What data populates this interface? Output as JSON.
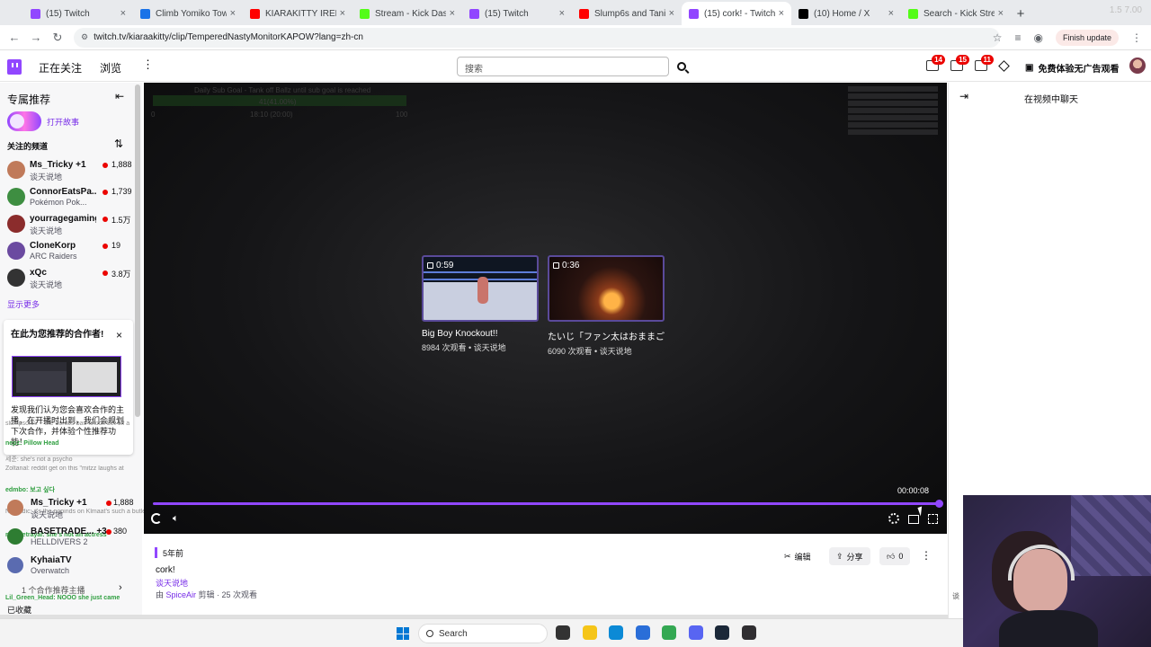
{
  "browser": {
    "tabs": [
      {
        "label": "(15) Twitch",
        "color": "#9146ff",
        "active": false
      },
      {
        "label": "Climb Yomiko Tower",
        "color": "#1a73e8",
        "active": false
      },
      {
        "label": "KIARAKITTY IRELAND",
        "color": "#ff0000",
        "active": false
      },
      {
        "label": "Stream - Kick Dashbo",
        "color": "#53fc18",
        "active": false
      },
      {
        "label": "(15) Twitch",
        "color": "#9146ff",
        "active": false
      },
      {
        "label": "Slump6s and Tania Br",
        "color": "#ff0000",
        "active": false
      },
      {
        "label": "(15) cork! - Twitch",
        "color": "#9146ff",
        "active": true
      },
      {
        "label": "(10) Home / X",
        "color": "#000000",
        "active": false
      },
      {
        "label": "Search - Kick Stream",
        "color": "#53fc18",
        "active": false
      }
    ],
    "url": "twitch.tv/kiaraakitty/clip/TemperedNastyMonitorKAPOW?lang=zh-cn",
    "finish_update": "Finish update",
    "window_hint": "1.5 7.00"
  },
  "topnav": {
    "following": "正在关注",
    "browse": "浏览",
    "more": "⋮",
    "search_placeholder": "搜索",
    "badges": [
      "14",
      "15",
      "11"
    ],
    "ad_free": "免费体验无广告观看"
  },
  "sidebar": {
    "title": "专属推荐",
    "collapse": "⇤",
    "story_label": "打开故事",
    "followed_heading": "关注的频道",
    "sort": "⇅",
    "channels": [
      {
        "name": "Ms_Tricky +1",
        "game": "谈天说地",
        "viewers": "1,888",
        "color": "#c07a5a"
      },
      {
        "name": "ConnorEatsPa...",
        "game": "Pokémon Pok...",
        "viewers": "1,739",
        "color": "#3e8e41"
      },
      {
        "name": "yourragegaming",
        "game": "谈天说地",
        "viewers": "1.5万",
        "color": "#8b2c2c"
      },
      {
        "name": "CloneKorp",
        "game": "ARC Raiders",
        "viewers": "19",
        "color": "#6b4aa0"
      },
      {
        "name": "xQc",
        "game": "谈天说地",
        "viewers": "3.8万",
        "color": "#333333"
      }
    ],
    "show_more": "显示更多",
    "promo": {
      "title": "在此为您推荐的合作者!",
      "close": "×",
      "text": "发现我们认为您会喜欢合作的主播，在开播时出到，我们会规划下次合作，并体验个性推荐功能！"
    }
  },
  "chat_overlay": {
    "lines": [
      {
        "text": "slumpsonn: ~ the doritos-bae knock-bet off a",
        "green": false
      },
      {
        "text": "nepz: Pillow Head",
        "green": true
      },
      {
        "text": "세준: she's not a psycho",
        "green": false
      },
      {
        "text": "Zoltanal: reddit get on this \"mitzz laughs at",
        "green": false
      },
      {
        "text": "edmbo: 보고 싶다",
        "green": true
      },
      {
        "text": "Nomadic: it's the popinds on Klmaat's such a butler",
        "green": false
      },
      {
        "text": "ray_betrayal: she's not an actress",
        "green": true
      },
      {
        "text": "Lil_Green_Head: NOOO she just came",
        "green": true
      },
      {
        "text": "nemo: the dom said bet is the window rreim",
        "green": false
      },
      {
        "text": "outlastaddict: Mostly clean",
        "green": false
      }
    ],
    "channels": [
      {
        "name": "Ms_Tricky +1",
        "game": "谈天说地",
        "viewers": "1,888",
        "color": "#c07a5a"
      },
      {
        "name": "BASETRADE... +3",
        "game": "HELLDIVERS 2",
        "viewers": "380",
        "color": "#2e7d32"
      },
      {
        "name": "KyhaiaTV",
        "game": "Overwatch",
        "viewers": "",
        "color": "#5a6bb0"
      }
    ],
    "recommend": "1 个合作推荐主播",
    "favorite": "已收藏"
  },
  "player": {
    "overlay_texts": [
      "Daily Sub Goal - Tank off Ballz until sub goal is reached",
      "41(41.00%)",
      "0",
      "18:10 (20:00)",
      "100"
    ],
    "recommendations": [
      {
        "duration": "0:59",
        "title": "Big Boy Knockout!!",
        "meta": "8984 次观看 • 谈天说地"
      },
      {
        "duration": "0:36",
        "title": "たいじ「ファン太はおままご...",
        "meta": "6090 次观看 • 谈天说地"
      }
    ],
    "timecode": "00:00:08",
    "progress": 1.0
  },
  "chat_panel": {
    "expand": "⇥",
    "title": "在视频中聊天",
    "side_text": "谈"
  },
  "info": {
    "age": "5年前",
    "title": "cork!",
    "category": "谈天说地",
    "meta_prefix": "由 ",
    "clipper": "SpiceAir",
    "meta_suffix": " 剪辑 · 25 次观看",
    "edit": "编辑",
    "share": "分享",
    "likes": "0"
  },
  "taskbar": {
    "search": "Search",
    "apps": [
      {
        "name": "task-view-icon",
        "color": "#333333"
      },
      {
        "name": "file-explorer-icon",
        "color": "#f5c518"
      },
      {
        "name": "edge-icon",
        "color": "#0c8ad6"
      },
      {
        "name": "store-icon",
        "color": "#2a6ed8"
      },
      {
        "name": "chrome-icon",
        "color": "#34a853"
      },
      {
        "name": "discord-icon",
        "color": "#5865f2"
      },
      {
        "name": "steam-icon",
        "color": "#1b2838"
      },
      {
        "name": "obs-icon",
        "color": "#302e31"
      }
    ]
  }
}
